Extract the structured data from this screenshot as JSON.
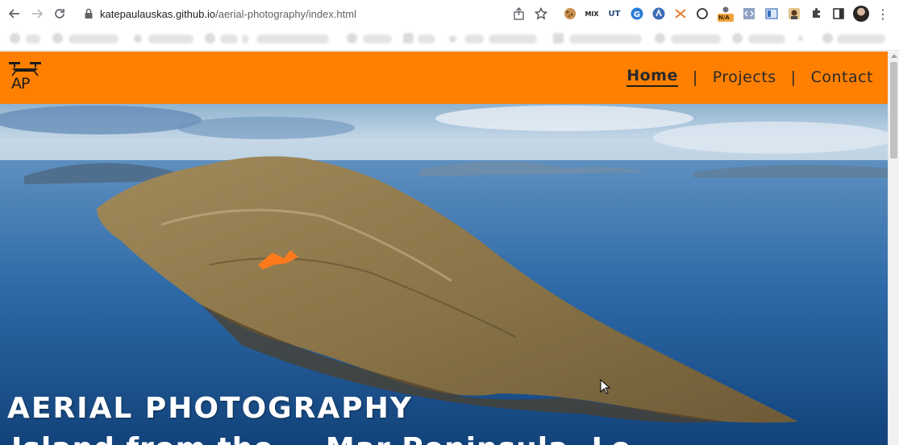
{
  "browser": {
    "url_host": "katepaulauskas.github.io",
    "url_path": "/aerial-photography/index.html",
    "extension_badge": "N/A",
    "extension_mix": "MIX",
    "extension_ut": "UT"
  },
  "site": {
    "nav": {
      "home": "Home",
      "separator_1": "|",
      "projects": "Projects",
      "separator_2": "|",
      "contact": "Contact"
    },
    "hero": {
      "title": "AERIAL PHOTOGRAPHY",
      "subtitle": "Island from the … Mar Peninsula, Lo…"
    },
    "logo_text": "AP"
  },
  "colors": {
    "header_bg": "#ff8000",
    "nav_text": "#2a2a2a",
    "hero_text": "#ffffff"
  }
}
